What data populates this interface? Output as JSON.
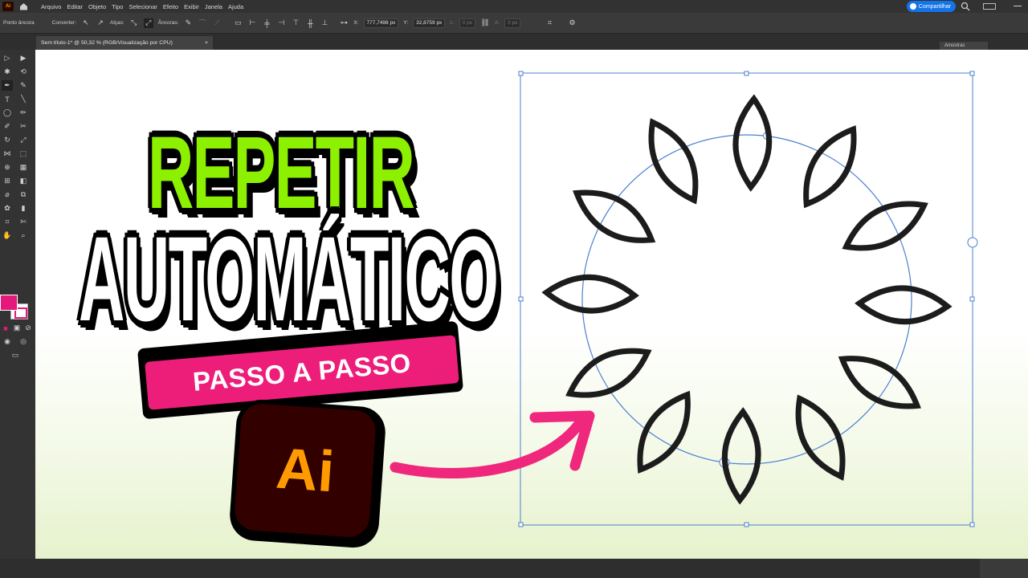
{
  "app": {
    "logo_text": "Ai",
    "menu": [
      "Arquivo",
      "Editar",
      "Objeto",
      "Tipo",
      "Selecionar",
      "Efeito",
      "Exibir",
      "Janela",
      "Ajuda"
    ],
    "share_label": "Compartilhar"
  },
  "controlbar": {
    "anchor_label": "Ponto âncora",
    "convert_label": "Converter:",
    "handles_label": "Alças:",
    "anchors_label": "Âncoras:",
    "x_label": "X:",
    "x_value": "777,7498 px",
    "y_label": "Y:",
    "y_value": "32,8759 px",
    "w_label": "L:",
    "w_value": "0 px",
    "h_label": "A:",
    "h_value": "0 px"
  },
  "document": {
    "tab_title": "Sem título-1* @ 50,32 % (RGB/Visualização por CPU)",
    "close_glyph": "×"
  },
  "panels": {
    "swatches_tab": "Amostras"
  },
  "colors": {
    "fill": "#e4197b",
    "accent_green": "#8cf000",
    "accent_pink": "#ec1e7a",
    "ai_orange": "#ff9a00",
    "selection_blue": "#4a7fd0"
  },
  "thumbnail": {
    "line1": "REPETIR",
    "line2": "AUTOMÁTICO",
    "subtitle": "PASSO A PASSO",
    "badge": "Ai"
  }
}
